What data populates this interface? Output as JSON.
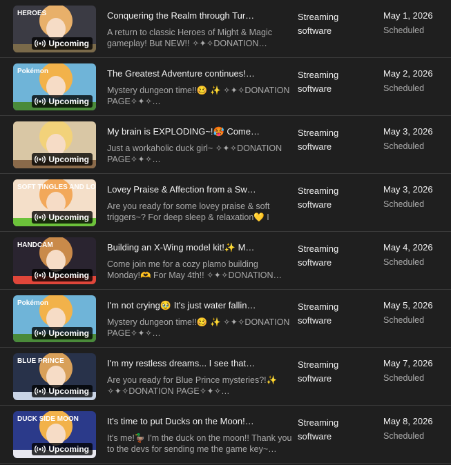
{
  "badge_label": "Upcoming",
  "colors": {
    "background": "#1f1f1f",
    "text_primary": "#f1f1f1",
    "text_secondary": "#aaaaaa",
    "divider": "#3a3a3a"
  },
  "videos": [
    {
      "title": "Conquering the Realm through Tur…",
      "description": "A return to classic Heroes of Might & Magic gameplay! But NEW!! ✧✦✧DONATION…",
      "category": "Streaming software",
      "date": "May 1, 2026",
      "status": "Scheduled",
      "thumb_text": "HEROES",
      "thumb_colors": [
        "#3b3b44",
        "#e8b06a",
        "#7a6a4a"
      ]
    },
    {
      "title": "The Greatest Adventure continues!…",
      "description": "Mystery dungeon time!!🥴 ✨ ✧✦✧DONATION PAGE✧✦✧…",
      "category": "Streaming software",
      "date": "May 2, 2026",
      "status": "Scheduled",
      "thumb_text": "Pokémon",
      "thumb_colors": [
        "#6fb4d8",
        "#f2b24a",
        "#4a8a3a"
      ]
    },
    {
      "title": "My brain is EXPLODING~!🥵 Come…",
      "description": "Just a workaholic duck girl~ ✧✦✧DONATION PAGE✧✦✧…",
      "category": "Streaming software",
      "date": "May 3, 2026",
      "status": "Scheduled",
      "thumb_text": "",
      "thumb_colors": [
        "#d9c7a5",
        "#f2d27a",
        "#8a6a4a"
      ]
    },
    {
      "title": "Lovey Praise & Affection from a Sw…",
      "description": "Are you ready for some lovey praise & soft triggers~? For deep sleep & relaxation💛 I hop…",
      "category": "Streaming software",
      "date": "May 3, 2026",
      "status": "Scheduled",
      "thumb_text": "SOFT TINGLES AND LOVEY PRAISE",
      "thumb_colors": [
        "#f4dfc9",
        "#f2a85a",
        "#6cc23a"
      ]
    },
    {
      "title": "Building an X-Wing model kit!✨ M…",
      "description": "Come join me for a cozy plamo building Monday!🫶 For May 4th!! ✧✦✧DONATION…",
      "category": "Streaming software",
      "date": "May 4, 2026",
      "status": "Scheduled",
      "thumb_text": "HANDCAM",
      "thumb_colors": [
        "#2a2430",
        "#c98a4a",
        "#e0463a"
      ]
    },
    {
      "title": "I'm not crying🥹 It's just water fallin…",
      "description": "Mystery dungeon time!!🥴 ✨ ✧✦✧DONATION PAGE✧✦✧…",
      "category": "Streaming software",
      "date": "May 5, 2026",
      "status": "Scheduled",
      "thumb_text": "Pokémon",
      "thumb_colors": [
        "#6fb4d8",
        "#f2b24a",
        "#4a8a3a"
      ]
    },
    {
      "title": "I'm my restless dreams... I see that…",
      "description": "Are you ready for Blue Prince mysteries?!✨ ✧✦✧DONATION PAGE✧✦✧…",
      "category": "Streaming software",
      "date": "May 7, 2026",
      "status": "Scheduled",
      "thumb_text": "BLUE PRINCE",
      "thumb_colors": [
        "#28324a",
        "#d8a05a",
        "#c9d4e6"
      ]
    },
    {
      "title": "It's time to put Ducks on the Moon!…",
      "description": "It's me!🦆 I'm the duck on the moon!! Thank you to the devs for sending me the game key~…",
      "category": "Streaming software",
      "date": "May 8, 2026",
      "status": "Scheduled",
      "thumb_text": "DUCK SIDE MOON",
      "thumb_colors": [
        "#2b3a8a",
        "#f2b24a",
        "#e8e8f0"
      ]
    }
  ]
}
